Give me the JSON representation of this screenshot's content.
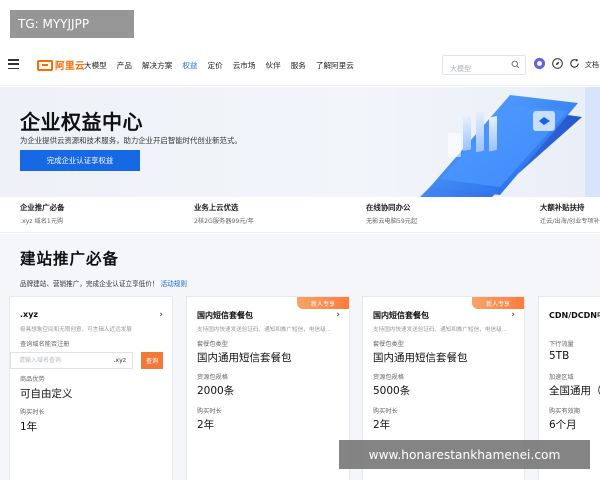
{
  "watermark_top": "TG: MYYJJPP",
  "watermark_bottom": "www.honarestankhamenei.com",
  "header": {
    "logo_text": "阿里云",
    "nav_items": [
      "大模型",
      "产品",
      "解决方案",
      "权益",
      "定价",
      "云市场",
      "伙伴",
      "服务",
      "了解阿里云"
    ],
    "active_index": 3,
    "search_placeholder": "大模型",
    "doc_label": "文档"
  },
  "banner": {
    "title": "企业权益中心",
    "subtitle": "为企业提供云资源和技术服务，助力企业开启智能时代创业新范式。",
    "cta": "完成企业认证享权益"
  },
  "features": [
    {
      "title": "企业推广必备",
      "desc": ".xyz 域名1元购"
    },
    {
      "title": "业务上云优选",
      "desc": "2核2G服务器99元/年"
    },
    {
      "title": "在线协同办公",
      "desc": "无影云电脑59元起"
    },
    {
      "title": "大额补贴扶持",
      "desc": "迁云/出海/创业专项补贴"
    }
  ],
  "section": {
    "title": "建站推广必备",
    "subtitle": "品牌建站、营销推广，完成企业认证立享低价！",
    "link": "活动规则"
  },
  "cards": [
    {
      "title": ".xyz",
      "desc": "极具想象空间和无限创意，可言辑人近远发展",
      "search_label": "查询域名能否注册",
      "search_placeholder": "请输入域名查询",
      "search_suffix": ".xyz",
      "search_button": "查询",
      "fields": [
        {
          "label": "商品优势",
          "value": "可自由定义"
        },
        {
          "label": "购买时长",
          "value": "1年"
        }
      ]
    },
    {
      "title": "国内短信套餐包",
      "badge": "新人专享",
      "desc": "支持国内快速发送验证码、通知和推广短信，电信级...",
      "fields": [
        {
          "label": "套餐包类型",
          "value": "国内通用短信套餐包"
        },
        {
          "label": "资源包规格",
          "value": "2000条"
        },
        {
          "label": "购买时长",
          "value": "2年"
        }
      ]
    },
    {
      "title": "国内短信套餐包",
      "badge": "新人专享",
      "desc": "支持国内快速发送验证码、通知和推广短信，电信级...",
      "fields": [
        {
          "label": "套餐包类型",
          "value": "国内通用短信套餐包"
        },
        {
          "label": "资源包规格",
          "value": "5000条"
        },
        {
          "label": "购买时长",
          "value": "2年"
        }
      ]
    },
    {
      "title": "CDN/DCDN中",
      "fields": [
        {
          "label": "下行流量",
          "value": "5TB"
        },
        {
          "label": "加速区域",
          "value": "全国通用（中"
        },
        {
          "label": "购买有效期",
          "value": "6个月"
        }
      ]
    }
  ],
  "colors": {
    "accent": "#1768e4",
    "brand": "#ff6a00",
    "badge": "#ff7b3a"
  }
}
